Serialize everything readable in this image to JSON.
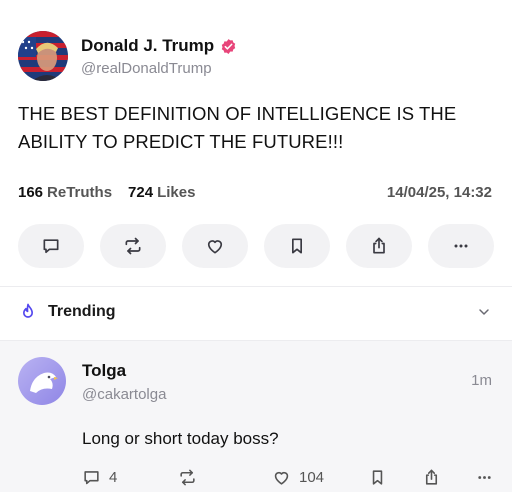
{
  "post": {
    "author_name": "Donald J. Trump",
    "handle": "@realDonaldTrump",
    "text": "THE BEST DEFINITION OF INTELLIGENCE IS THE ABILITY TO PREDICT THE FUTURE!!!",
    "retruths_count": "166",
    "retruths_label": "ReTruths",
    "likes_count": "724",
    "likes_label": "Likes",
    "timestamp": "14/04/25, 14:32"
  },
  "actions": [
    "comment-icon",
    "retruth-icon",
    "heart-icon",
    "bookmark-icon",
    "share-icon",
    "more-icon"
  ],
  "trending": {
    "label": "Trending"
  },
  "reply": {
    "author_name": "Tolga",
    "handle": "@cakartolga",
    "time": "1m",
    "text": "Long or short today boss?",
    "comments_count": "4",
    "likes_count": "104"
  },
  "colors": {
    "verified": "#e8457a",
    "accent": "#5448ee",
    "reply_bg": "#f6f6f8"
  }
}
